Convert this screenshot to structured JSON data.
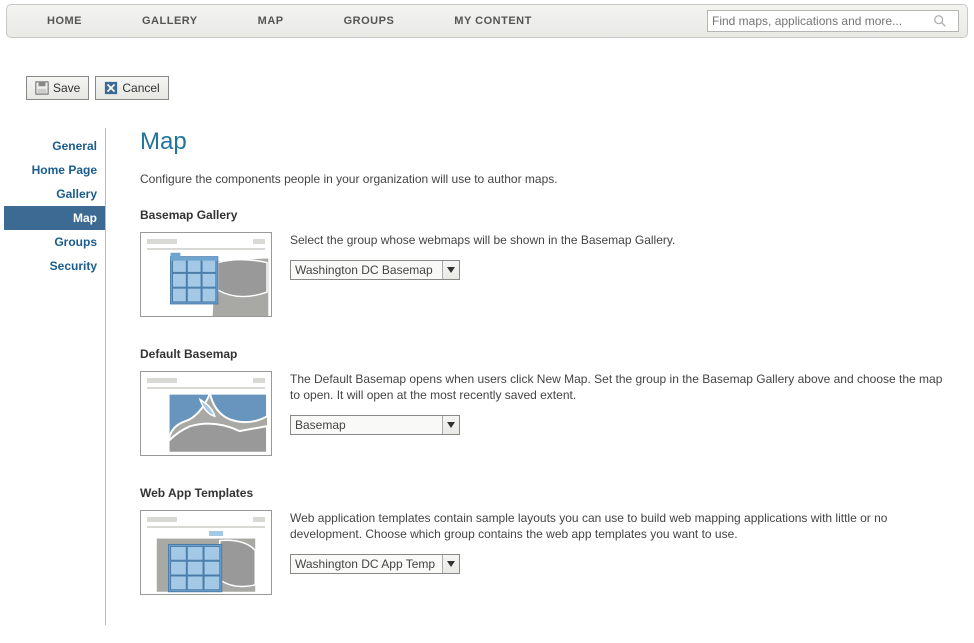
{
  "nav": {
    "items": [
      "HOME",
      "GALLERY",
      "MAP",
      "GROUPS",
      "MY CONTENT"
    ],
    "search_placeholder": "Find maps, applications and more..."
  },
  "actions": {
    "save": "Save",
    "cancel": "Cancel"
  },
  "sidebar": {
    "items": [
      {
        "label": "General"
      },
      {
        "label": "Home Page"
      },
      {
        "label": "Gallery"
      },
      {
        "label": "Map",
        "active": true
      },
      {
        "label": "Groups"
      },
      {
        "label": "Security"
      }
    ]
  },
  "page": {
    "title": "Map",
    "intro": "Configure the components people in your organization will use to author maps."
  },
  "sections": {
    "basemap_gallery": {
      "title": "Basemap Gallery",
      "desc": "Select the group whose webmaps will be shown in the Basemap Gallery.",
      "dropdown": "Washington DC Basemap"
    },
    "default_basemap": {
      "title": "Default Basemap",
      "desc": "The Default Basemap opens when users click New Map. Set the group in the Basemap Gallery above and choose the map to open. It will open at the most recently saved extent.",
      "dropdown": "Basemap"
    },
    "web_app_templates": {
      "title": "Web App Templates",
      "desc": "Web application templates contain sample layouts you can use to build web mapping applications with little or no development. Choose which group contains the web app templates you want to use.",
      "dropdown": "Washington DC App Temp"
    }
  }
}
